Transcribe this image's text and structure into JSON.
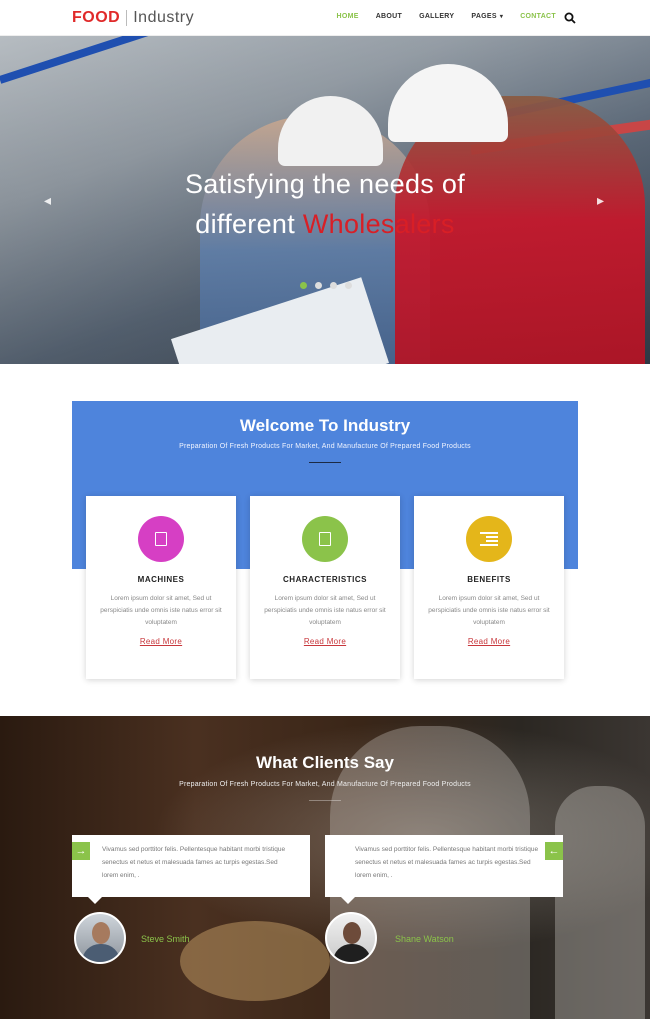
{
  "header": {
    "logo_strong": "FOOD",
    "logo_light": "Industry",
    "nav": [
      {
        "label": "HOME",
        "active": true
      },
      {
        "label": "ABOUT",
        "active": false
      },
      {
        "label": "GALLERY",
        "active": false
      },
      {
        "label": "PAGES",
        "active": false,
        "dropdown": true
      },
      {
        "label": "CONTACT",
        "active": true
      }
    ]
  },
  "hero": {
    "title_line1": "Satisfying the needs of",
    "title_line2_prefix": "different",
    "title_line2_highlight": "Wholesalers",
    "slide_count": 4,
    "active_slide": 1
  },
  "welcome": {
    "title": "Welcome To Industry",
    "subtitle": "Preparation Of Fresh Products For Market, And Manufacture Of Prepared Food Products",
    "cards": [
      {
        "title": "MACHINES",
        "text": "Lorem ipsum dolor sit amet, Sed ut perspiciatis unde omnis iste natus error sit voluptatem",
        "link": "Read More",
        "color": "#d63fc4",
        "icon": "document-icon"
      },
      {
        "title": "CHARACTERISTICS",
        "text": "Lorem ipsum dolor sit amet, Sed ut perspiciatis unde omnis iste natus error sit voluptatem",
        "link": "Read More",
        "color": "#8bc34a",
        "icon": "document-icon"
      },
      {
        "title": "BENEFITS",
        "text": "Lorem ipsum dolor sit amet, Sed ut perspiciatis unde omnis iste natus error sit voluptatem",
        "link": "Read More",
        "color": "#e4b61a",
        "icon": "list-indent-icon"
      }
    ]
  },
  "testimonials": {
    "title": "What Clients Say",
    "subtitle": "Preparation Of Fresh Products For Market, And Manufacture Of Prepared Food Products",
    "items": [
      {
        "quote": "Vivamus sed porttitor felis. Pellentesque habitant morbi tristique senectus et netus et malesuada fames ac turpis egestas.Sed lorem enim, .",
        "name": "Steve Smith"
      },
      {
        "quote": "Vivamus sed porttitor felis. Pellentesque habitant morbi tristique senectus et netus et malesuada fames ac turpis egestas.Sed lorem enim, .",
        "name": "Shane Watson"
      }
    ],
    "prev_arrow": "→",
    "next_arrow": "←"
  },
  "colors": {
    "brand_red": "#e02a2a",
    "accent_green": "#8bc34a",
    "welcome_blue": "#4e84dc",
    "link_red": "#c8373c"
  }
}
